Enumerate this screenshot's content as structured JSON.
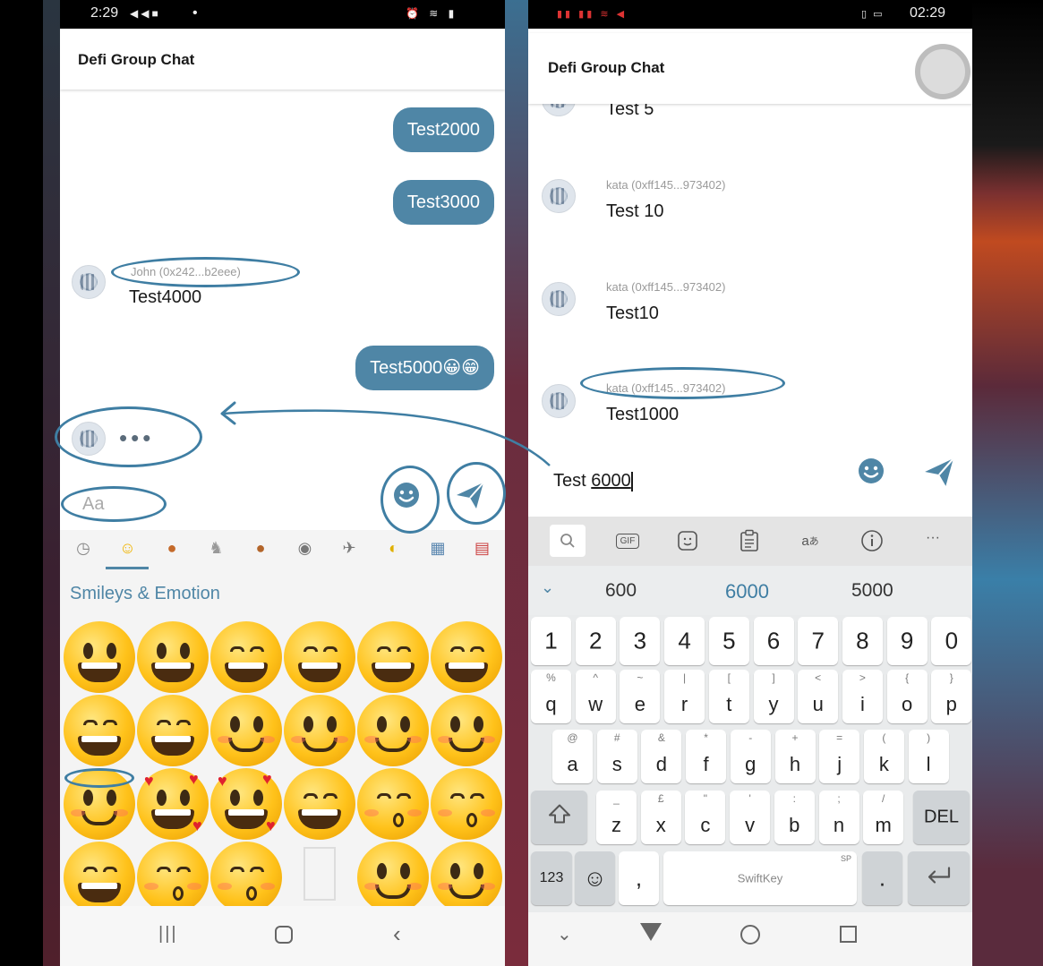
{
  "colors": {
    "accent": "#4f86a6",
    "annotation": "#3f7ea3",
    "sender_gray": "#9a9a9a"
  },
  "left": {
    "status": {
      "time": "2:29",
      "dot": "•"
    },
    "title": "Defi Group Chat",
    "outgoing": [
      "Test2000",
      "Test3000",
      "Test5000😀😁"
    ],
    "incoming": {
      "sender": "John (0x242...b2eee)",
      "text": "Test4000"
    },
    "typing_indicator": "•••",
    "input_placeholder": "Aa",
    "emoji_tabs": [
      "clock-icon",
      "smiley-icon",
      "person-icon",
      "animal-icon",
      "food-icon",
      "ball-icon",
      "plane-icon",
      "bulb-icon",
      "symbols-icon",
      "flag-icon"
    ],
    "emoji_section_title": "Smileys & Emotion"
  },
  "right": {
    "status": {
      "time": "02:29"
    },
    "title": "Defi Group Chat",
    "messages": [
      {
        "sender": "",
        "text": "Test 5"
      },
      {
        "sender": "kata (0xff145...973402)",
        "text": "Test 10"
      },
      {
        "sender": "kata (0xff145...973402)",
        "text": "Test10"
      },
      {
        "sender": "kata (0xff145...973402)",
        "text": "Test1000"
      }
    ],
    "input_value_prefix": "Test ",
    "input_value_underlined": "6000",
    "suggestions": [
      "600",
      "6000",
      "5000"
    ],
    "keyboard": {
      "number_row": [
        "1",
        "2",
        "3",
        "4",
        "5",
        "6",
        "7",
        "8",
        "9",
        "0"
      ],
      "row1": [
        {
          "k": "q",
          "h": "%"
        },
        {
          "k": "w",
          "h": "^"
        },
        {
          "k": "e",
          "h": "~"
        },
        {
          "k": "r",
          "h": "|"
        },
        {
          "k": "t",
          "h": "["
        },
        {
          "k": "y",
          "h": "]"
        },
        {
          "k": "u",
          "h": "<"
        },
        {
          "k": "i",
          "h": ">"
        },
        {
          "k": "o",
          "h": "{"
        },
        {
          "k": "p",
          "h": "}"
        }
      ],
      "row2": [
        {
          "k": "a",
          "h": "@"
        },
        {
          "k": "s",
          "h": "#"
        },
        {
          "k": "d",
          "h": "&"
        },
        {
          "k": "f",
          "h": "*"
        },
        {
          "k": "g",
          "h": "-"
        },
        {
          "k": "h",
          "h": "+"
        },
        {
          "k": "j",
          "h": "="
        },
        {
          "k": "k",
          "h": "("
        },
        {
          "k": "l",
          "h": ")"
        }
      ],
      "row3": [
        {
          "k": "z",
          "h": "_"
        },
        {
          "k": "x",
          "h": "£"
        },
        {
          "k": "c",
          "h": "\""
        },
        {
          "k": "v",
          "h": "'"
        },
        {
          "k": "b",
          "h": ":"
        },
        {
          "k": "n",
          "h": ";"
        },
        {
          "k": "m",
          "h": "/"
        }
      ],
      "shift_icon": "shift-icon",
      "delete_label": "DEL",
      "numbers_label": "123",
      "emoji_key": "☺",
      "comma_label": ",",
      "space_label": "SwiftKey",
      "space_hint": "SP",
      "period_label": ".",
      "enter_icon": "enter-icon"
    },
    "toolbar_icons": [
      "search-icon",
      "gif-icon",
      "sticker-icon",
      "clipboard-icon",
      "translate-icon",
      "info-icon",
      "more-icon"
    ],
    "gif_label": "GIF",
    "more_label": "···"
  }
}
